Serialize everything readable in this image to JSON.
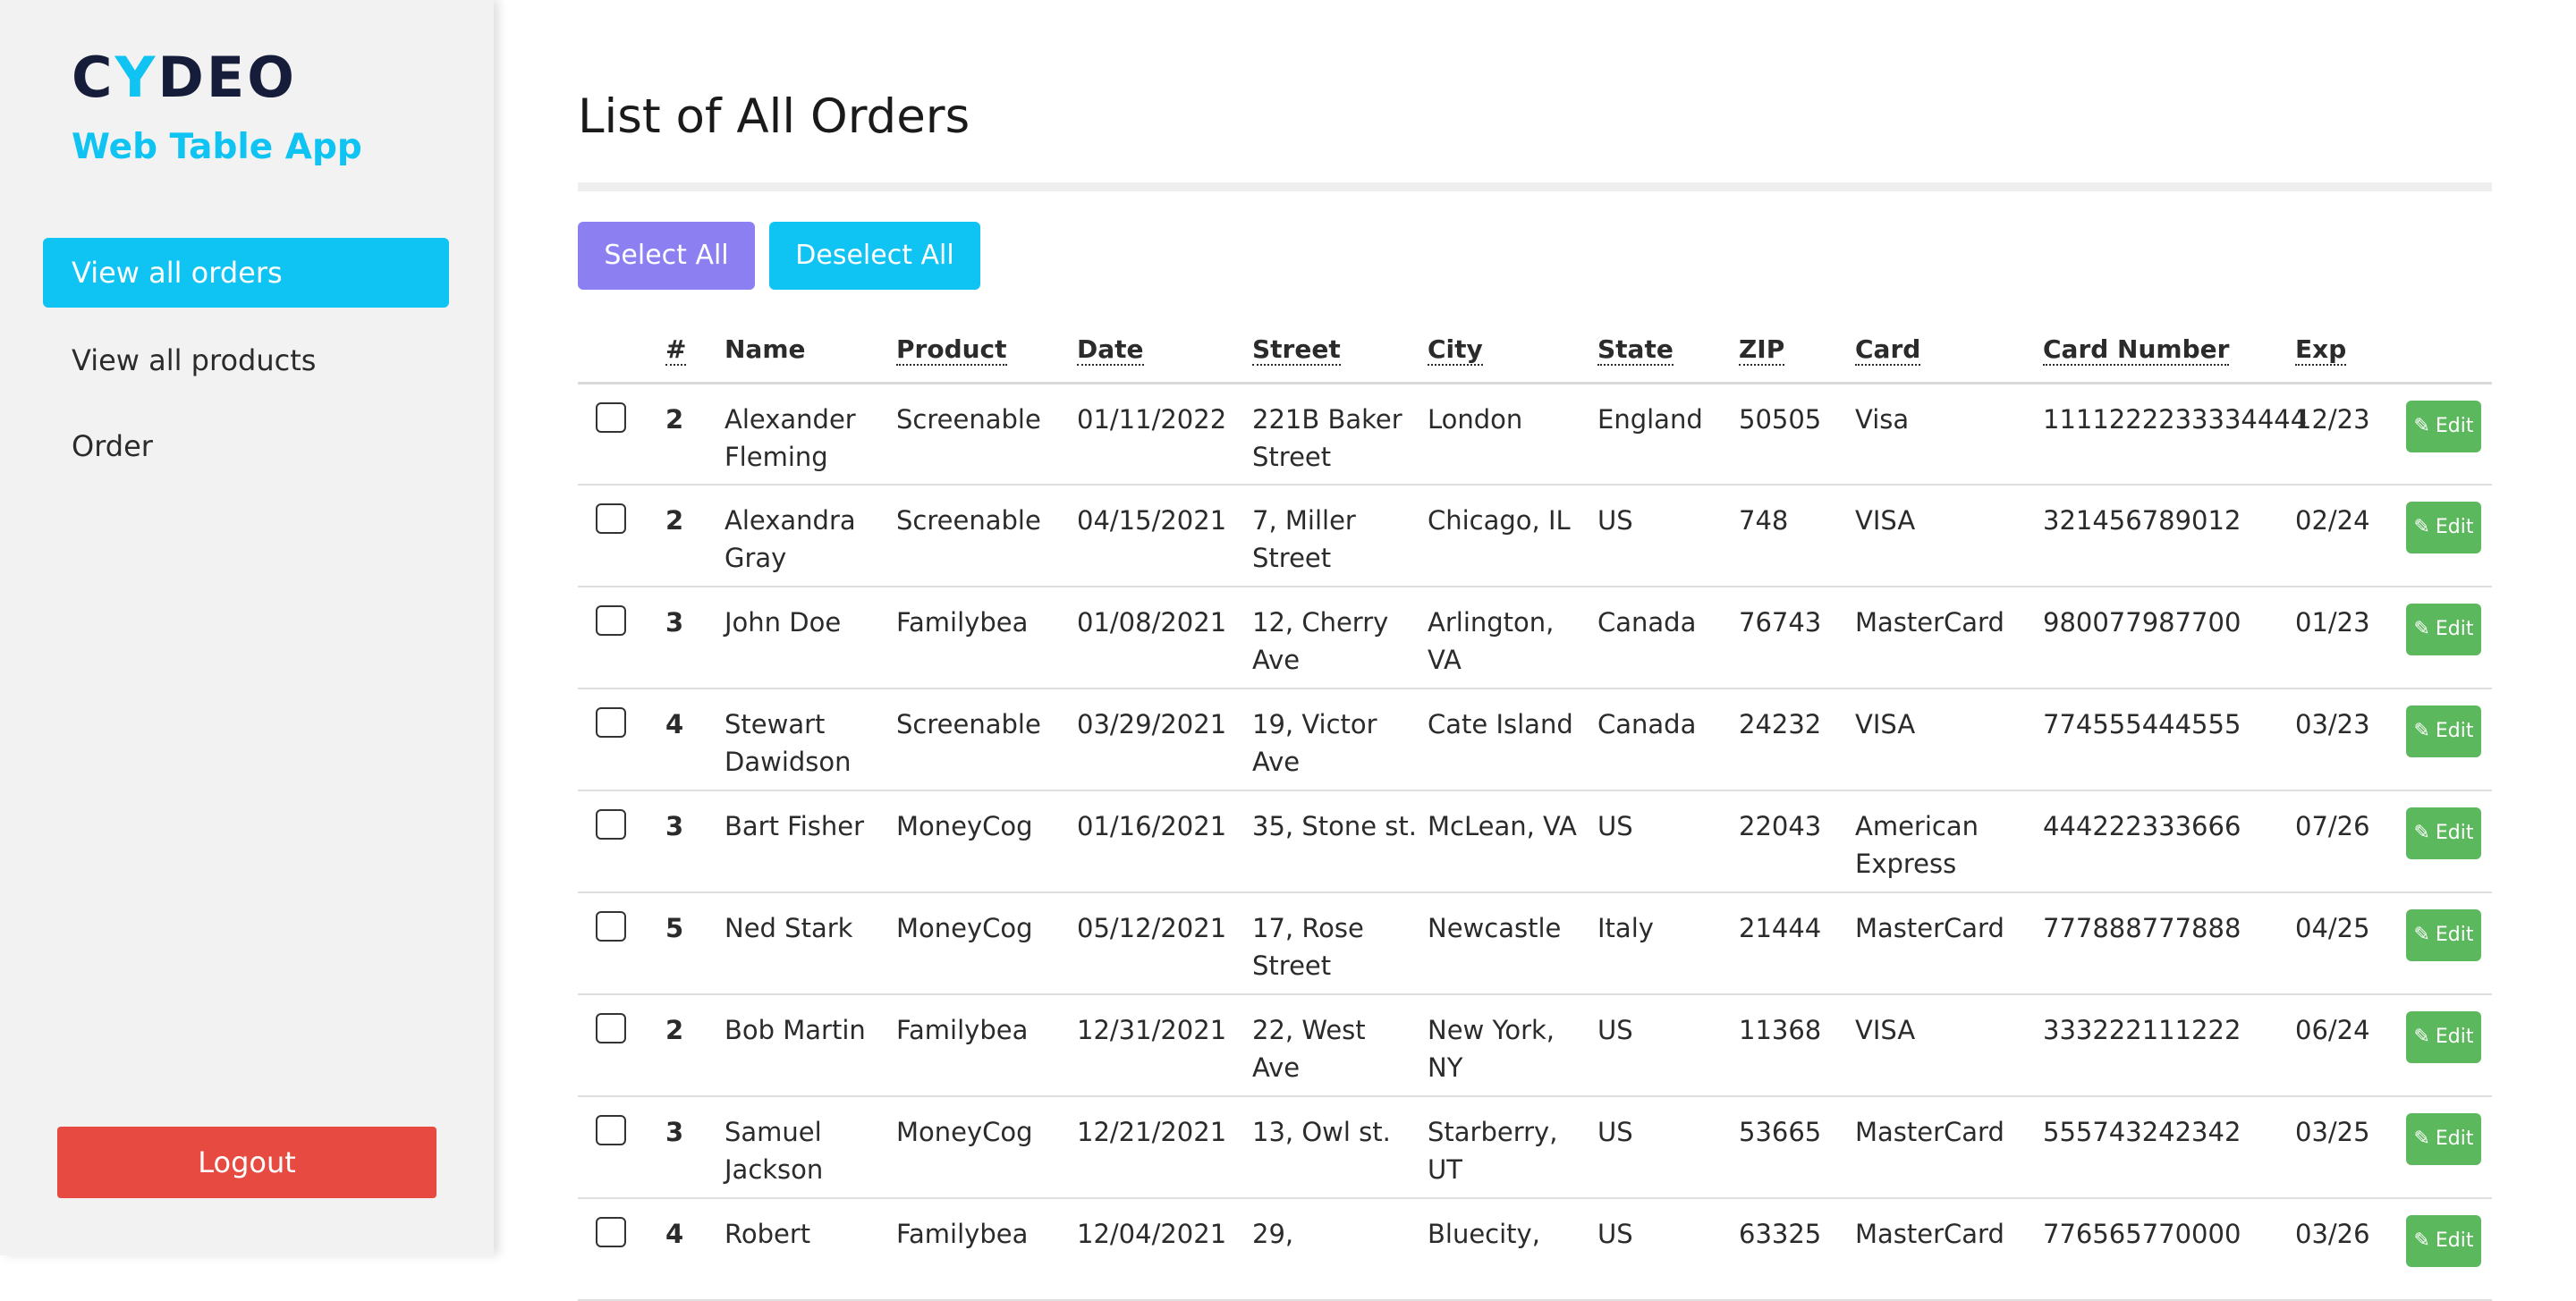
{
  "sidebar": {
    "logo": {
      "part1": "C",
      "accent": "Y",
      "part2": "DEO"
    },
    "app_title": "Web Table App",
    "nav": [
      {
        "label": "View all orders",
        "active": true
      },
      {
        "label": "View all products",
        "active": false
      },
      {
        "label": "Order",
        "active": false
      }
    ],
    "logout_label": "Logout"
  },
  "main": {
    "title": "List of All Orders",
    "select_all_label": "Select All",
    "deselect_all_label": "Deselect All",
    "edit_label": "Edit",
    "colors": {
      "accent": "#0fc3f3",
      "select": "#8c7ff2",
      "edit": "#5cb85c",
      "logout": "#e64a40"
    },
    "columns": [
      "#",
      "Name",
      "Product",
      "Date",
      "Street",
      "City",
      "State",
      "ZIP",
      "Card",
      "Card Number",
      "Exp"
    ],
    "rows": [
      {
        "num": "2",
        "name": "Alexander Fleming",
        "product": "Screenable",
        "date": "01/11/2022",
        "street": "221B Baker Street",
        "city": "London",
        "state": "England",
        "zip": "50505",
        "card": "Visa",
        "card_number": "1111222233334444",
        "exp": "12/23"
      },
      {
        "num": "2",
        "name": "Alexandra Gray",
        "product": "Screenable",
        "date": "04/15/2021",
        "street": "7, Miller Street",
        "city": "Chicago, IL",
        "state": "US",
        "zip": "748",
        "card": "VISA",
        "card_number": "321456789012",
        "exp": "02/24"
      },
      {
        "num": "3",
        "name": "John Doe",
        "product": "Familybea",
        "date": "01/08/2021",
        "street": "12, Cherry Ave",
        "city": "Arlington, VA",
        "state": "Canada",
        "zip": "76743",
        "card": "MasterCard",
        "card_number": "980077987700",
        "exp": "01/23"
      },
      {
        "num": "4",
        "name": "Stewart Dawidson",
        "product": "Screenable",
        "date": "03/29/2021",
        "street": "19, Victor Ave",
        "city": "Cate Island",
        "state": "Canada",
        "zip": "24232",
        "card": "VISA",
        "card_number": "774555444555",
        "exp": "03/23"
      },
      {
        "num": "3",
        "name": "Bart Fisher",
        "product": "MoneyCog",
        "date": "01/16/2021",
        "street": "35, Stone st.",
        "city": "McLean, VA",
        "state": "US",
        "zip": "22043",
        "card": "American Express",
        "card_number": "444222333666",
        "exp": "07/26"
      },
      {
        "num": "5",
        "name": "Ned Stark",
        "product": "MoneyCog",
        "date": "05/12/2021",
        "street": "17, Rose Street",
        "city": "Newcastle",
        "state": "Italy",
        "zip": "21444",
        "card": "MasterCard",
        "card_number": "777888777888",
        "exp": "04/25"
      },
      {
        "num": "2",
        "name": "Bob Martin",
        "product": "Familybea",
        "date": "12/31/2021",
        "street": "22, West Ave",
        "city": "New York, NY",
        "state": "US",
        "zip": "11368",
        "card": "VISA",
        "card_number": "333222111222",
        "exp": "06/24"
      },
      {
        "num": "3",
        "name": "Samuel Jackson",
        "product": "MoneyCog",
        "date": "12/21/2021",
        "street": "13, Owl st.",
        "city": "Starberry, UT",
        "state": "US",
        "zip": "53665",
        "card": "MasterCard",
        "card_number": "555743242342",
        "exp": "03/25"
      },
      {
        "num": "4",
        "name": "Robert",
        "product": "Familybea",
        "date": "12/04/2021",
        "street": "29,",
        "city": "Bluecity,",
        "state": "US",
        "zip": "63325",
        "card": "MasterCard",
        "card_number": "776565770000",
        "exp": "03/26"
      }
    ]
  }
}
